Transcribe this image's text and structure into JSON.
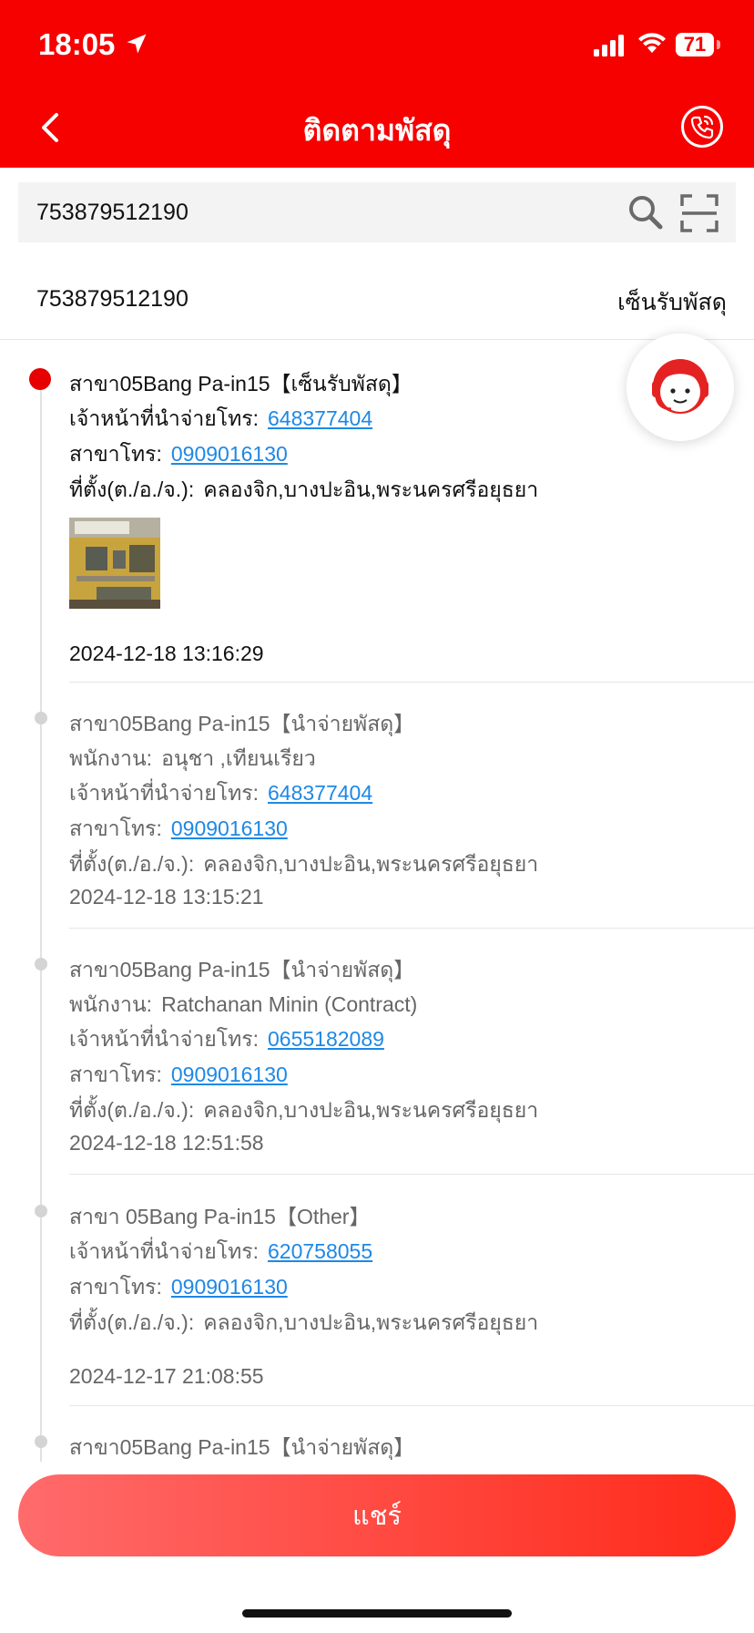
{
  "status_bar": {
    "time": "18:05",
    "battery": "71"
  },
  "header": {
    "title": "ติดตามพัสดุ"
  },
  "search": {
    "value": "753879512190"
  },
  "summary": {
    "tracking_no": "753879512190",
    "status": "เซ็นรับพัสดุ"
  },
  "entries": [
    {
      "title": "สาขา05Bang Pa-in15【เซ็นรับพัสดุ】",
      "courier_label": "เจ้าหน้าที่นำจ่ายโทร:",
      "courier_phone": "648377404",
      "branch_label": "สาขาโทร:",
      "branch_phone": "0909016130",
      "location_label": "ที่ตั้ง(ต./อ./จ.):",
      "location": "คลองจิก,บางปะอิน,พระนครศรีอยุธยา",
      "time": "2024-12-18 13:16:29"
    },
    {
      "title": "สาขา05Bang Pa-in15【นำจ่ายพัสดุ】",
      "staff_label": "พนักงาน:",
      "staff": "อนุชา ,เทียนเรียว",
      "courier_label": "เจ้าหน้าที่นำจ่ายโทร:",
      "courier_phone": "648377404",
      "branch_label": "สาขาโทร:",
      "branch_phone": "0909016130",
      "location_label": "ที่ตั้ง(ต./อ./จ.):",
      "location": "คลองจิก,บางปะอิน,พระนครศรีอยุธยา",
      "time": "2024-12-18 13:15:21"
    },
    {
      "title": "สาขา05Bang Pa-in15【นำจ่ายพัสดุ】",
      "staff_label": "พนักงาน:",
      "staff": "Ratchanan Minin (Contract)",
      "courier_label": "เจ้าหน้าที่นำจ่ายโทร:",
      "courier_phone": "0655182089",
      "branch_label": "สาขาโทร:",
      "branch_phone": "0909016130",
      "location_label": "ที่ตั้ง(ต./อ./จ.):",
      "location": "คลองจิก,บางปะอิน,พระนครศรีอยุธยา",
      "time": "2024-12-18 12:51:58"
    },
    {
      "title": "สาขา 05Bang Pa-in15【Other】",
      "courier_label": "เจ้าหน้าที่นำจ่ายโทร:",
      "courier_phone": "620758055",
      "branch_label": "สาขาโทร:",
      "branch_phone": "0909016130",
      "location_label": "ที่ตั้ง(ต./อ./จ.):",
      "location": "คลองจิก,บางปะอิน,พระนครศรีอยุธยา",
      "time": "2024-12-17 21:08:55"
    },
    {
      "title": "สาขา05Bang Pa-in15【นำจ่ายพัสดุ】"
    }
  ],
  "share_button": "แชร์",
  "colors": {
    "brand_red": "#f60000",
    "link_blue": "#1e88e5"
  }
}
